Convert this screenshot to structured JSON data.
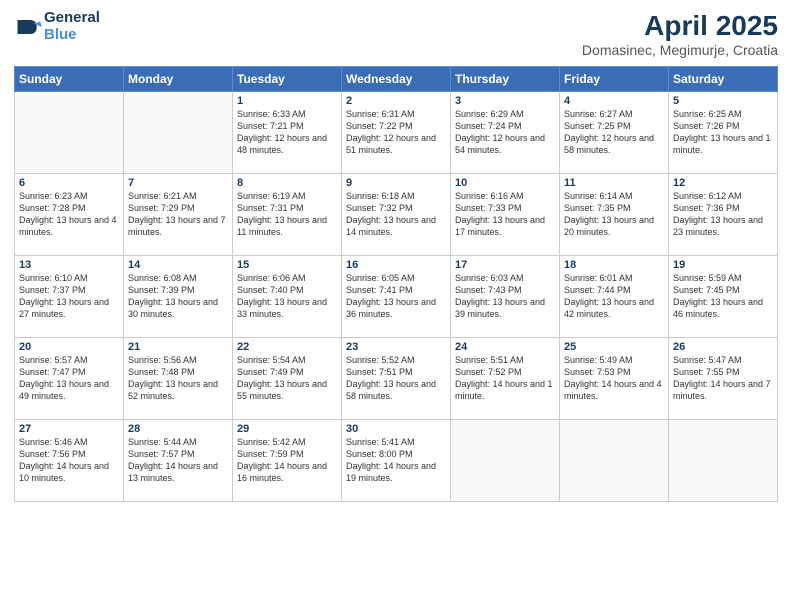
{
  "header": {
    "logo_line1": "General",
    "logo_line2": "Blue",
    "title": "April 2025",
    "subtitle": "Domasinec, Megimurje, Croatia"
  },
  "weekdays": [
    "Sunday",
    "Monday",
    "Tuesday",
    "Wednesday",
    "Thursday",
    "Friday",
    "Saturday"
  ],
  "weeks": [
    [
      {
        "day": "",
        "info": ""
      },
      {
        "day": "",
        "info": ""
      },
      {
        "day": "1",
        "info": "Sunrise: 6:33 AM\nSunset: 7:21 PM\nDaylight: 12 hours and 48 minutes."
      },
      {
        "day": "2",
        "info": "Sunrise: 6:31 AM\nSunset: 7:22 PM\nDaylight: 12 hours and 51 minutes."
      },
      {
        "day": "3",
        "info": "Sunrise: 6:29 AM\nSunset: 7:24 PM\nDaylight: 12 hours and 54 minutes."
      },
      {
        "day": "4",
        "info": "Sunrise: 6:27 AM\nSunset: 7:25 PM\nDaylight: 12 hours and 58 minutes."
      },
      {
        "day": "5",
        "info": "Sunrise: 6:25 AM\nSunset: 7:26 PM\nDaylight: 13 hours and 1 minute."
      }
    ],
    [
      {
        "day": "6",
        "info": "Sunrise: 6:23 AM\nSunset: 7:28 PM\nDaylight: 13 hours and 4 minutes."
      },
      {
        "day": "7",
        "info": "Sunrise: 6:21 AM\nSunset: 7:29 PM\nDaylight: 13 hours and 7 minutes."
      },
      {
        "day": "8",
        "info": "Sunrise: 6:19 AM\nSunset: 7:31 PM\nDaylight: 13 hours and 11 minutes."
      },
      {
        "day": "9",
        "info": "Sunrise: 6:18 AM\nSunset: 7:32 PM\nDaylight: 13 hours and 14 minutes."
      },
      {
        "day": "10",
        "info": "Sunrise: 6:16 AM\nSunset: 7:33 PM\nDaylight: 13 hours and 17 minutes."
      },
      {
        "day": "11",
        "info": "Sunrise: 6:14 AM\nSunset: 7:35 PM\nDaylight: 13 hours and 20 minutes."
      },
      {
        "day": "12",
        "info": "Sunrise: 6:12 AM\nSunset: 7:36 PM\nDaylight: 13 hours and 23 minutes."
      }
    ],
    [
      {
        "day": "13",
        "info": "Sunrise: 6:10 AM\nSunset: 7:37 PM\nDaylight: 13 hours and 27 minutes."
      },
      {
        "day": "14",
        "info": "Sunrise: 6:08 AM\nSunset: 7:39 PM\nDaylight: 13 hours and 30 minutes."
      },
      {
        "day": "15",
        "info": "Sunrise: 6:06 AM\nSunset: 7:40 PM\nDaylight: 13 hours and 33 minutes."
      },
      {
        "day": "16",
        "info": "Sunrise: 6:05 AM\nSunset: 7:41 PM\nDaylight: 13 hours and 36 minutes."
      },
      {
        "day": "17",
        "info": "Sunrise: 6:03 AM\nSunset: 7:43 PM\nDaylight: 13 hours and 39 minutes."
      },
      {
        "day": "18",
        "info": "Sunrise: 6:01 AM\nSunset: 7:44 PM\nDaylight: 13 hours and 42 minutes."
      },
      {
        "day": "19",
        "info": "Sunrise: 5:59 AM\nSunset: 7:45 PM\nDaylight: 13 hours and 46 minutes."
      }
    ],
    [
      {
        "day": "20",
        "info": "Sunrise: 5:57 AM\nSunset: 7:47 PM\nDaylight: 13 hours and 49 minutes."
      },
      {
        "day": "21",
        "info": "Sunrise: 5:56 AM\nSunset: 7:48 PM\nDaylight: 13 hours and 52 minutes."
      },
      {
        "day": "22",
        "info": "Sunrise: 5:54 AM\nSunset: 7:49 PM\nDaylight: 13 hours and 55 minutes."
      },
      {
        "day": "23",
        "info": "Sunrise: 5:52 AM\nSunset: 7:51 PM\nDaylight: 13 hours and 58 minutes."
      },
      {
        "day": "24",
        "info": "Sunrise: 5:51 AM\nSunset: 7:52 PM\nDaylight: 14 hours and 1 minute."
      },
      {
        "day": "25",
        "info": "Sunrise: 5:49 AM\nSunset: 7:53 PM\nDaylight: 14 hours and 4 minutes."
      },
      {
        "day": "26",
        "info": "Sunrise: 5:47 AM\nSunset: 7:55 PM\nDaylight: 14 hours and 7 minutes."
      }
    ],
    [
      {
        "day": "27",
        "info": "Sunrise: 5:46 AM\nSunset: 7:56 PM\nDaylight: 14 hours and 10 minutes."
      },
      {
        "day": "28",
        "info": "Sunrise: 5:44 AM\nSunset: 7:57 PM\nDaylight: 14 hours and 13 minutes."
      },
      {
        "day": "29",
        "info": "Sunrise: 5:42 AM\nSunset: 7:59 PM\nDaylight: 14 hours and 16 minutes."
      },
      {
        "day": "30",
        "info": "Sunrise: 5:41 AM\nSunset: 8:00 PM\nDaylight: 14 hours and 19 minutes."
      },
      {
        "day": "",
        "info": ""
      },
      {
        "day": "",
        "info": ""
      },
      {
        "day": "",
        "info": ""
      }
    ]
  ]
}
